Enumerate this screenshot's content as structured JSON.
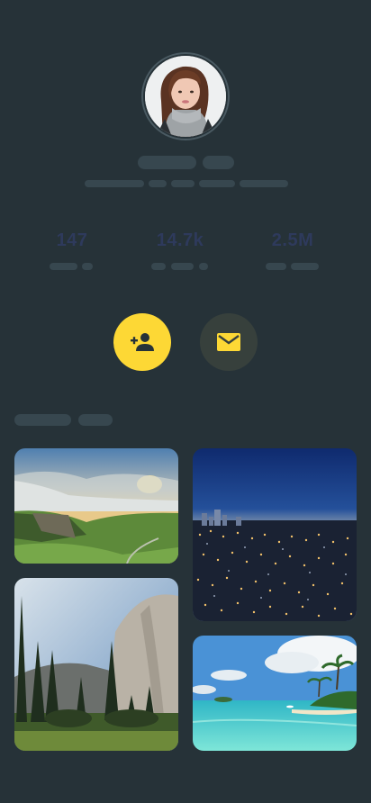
{
  "profile": {
    "avatar_icon": "profile-photo",
    "follow_icon": "person-add-icon",
    "message_icon": "mail-icon"
  },
  "stats": [
    {
      "value": "147"
    },
    {
      "value": "14.7k"
    },
    {
      "value": "2.5M"
    }
  ],
  "colors": {
    "background": "#263238",
    "skeleton": "#37474f",
    "accent": "#fdd835",
    "message_button": "#37403c"
  },
  "gallery": {
    "photos": [
      {
        "name": "mountain-valley-sunrise"
      },
      {
        "name": "city-night-skyline"
      },
      {
        "name": "granite-cliff-forest"
      },
      {
        "name": "tropical-beach-lagoon"
      }
    ]
  }
}
